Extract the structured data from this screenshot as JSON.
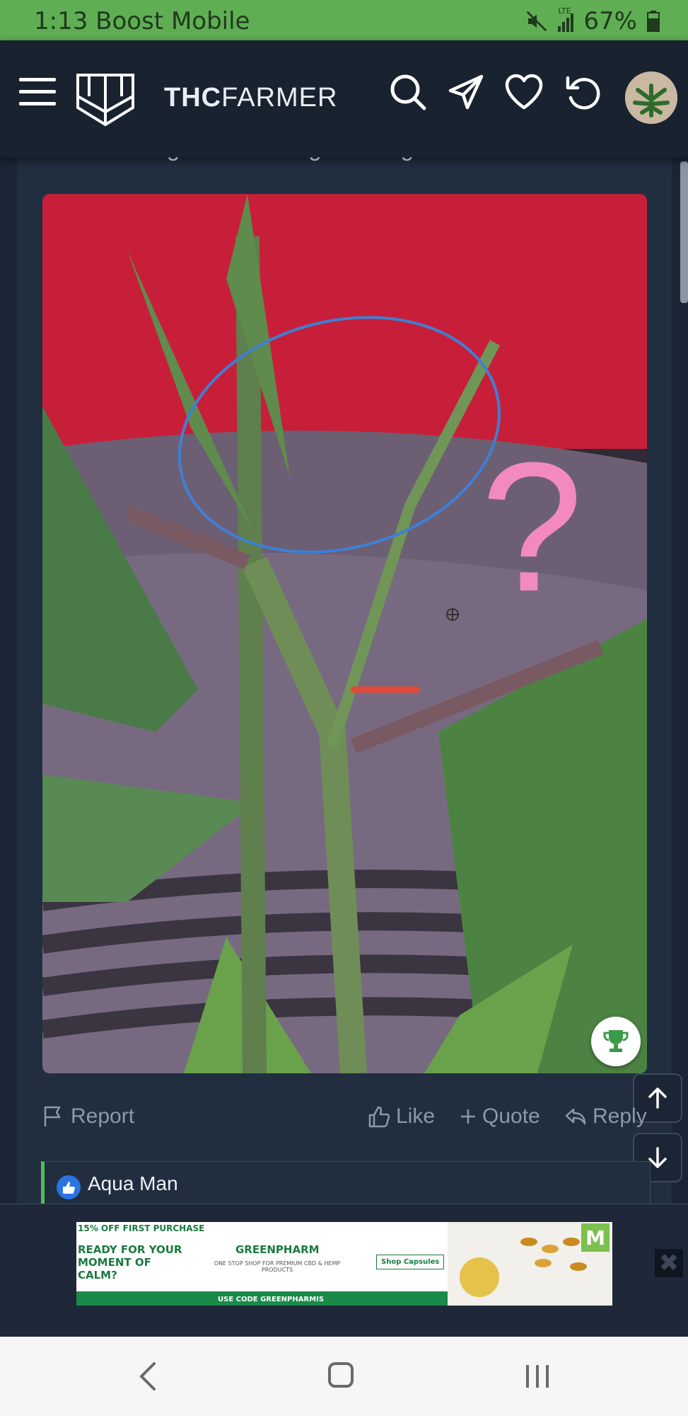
{
  "status": {
    "time_carrier": "1:13 Boost Mobile",
    "network": "LTE",
    "battery": "67%"
  },
  "header": {
    "logo_bold": "THC",
    "logo_light": "FARMER"
  },
  "post": {
    "cut_text": "Cut here to get new side growth right?",
    "actions": {
      "report": "Report",
      "like": "Like",
      "quote": "Quote",
      "reply": "Reply"
    },
    "reaction_names": "Aqua Man"
  },
  "ad": {
    "offer": "15% OFF FIRST PURCHASE",
    "headline": "READY FOR YOUR MOMENT OF CALM?",
    "brand": "GREENPHARM",
    "tagline": "ONE STOP SHOP FOR PREMIUM CBD & HEMP PRODUCTS",
    "cta": "Shop Capsules",
    "code_label": "USE CODE GREENPHARMIS"
  },
  "colors": {
    "status_bg": "#5fae54",
    "header_bg": "#19222f",
    "content_bg": "#212e40",
    "like_blue": "#2a74e0",
    "accent_green": "#4fbf5a"
  }
}
